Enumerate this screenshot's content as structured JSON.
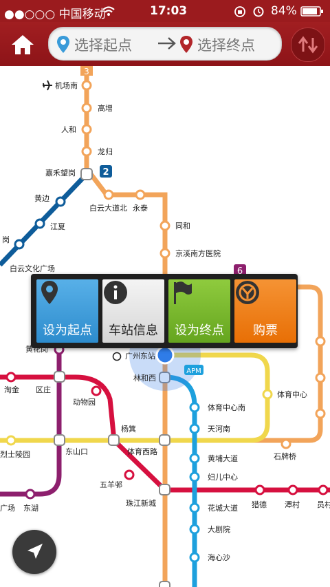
{
  "status_bar": {
    "carrier": "●●○○○ 中国移动",
    "time": "17:03",
    "battery": "84%"
  },
  "toolbar": {
    "home_icon": "home-icon",
    "start_placeholder": "选择起点",
    "end_placeholder": "选择终点",
    "swap_icon": "swap-route-icon"
  },
  "popup": {
    "set_start": "设为起点",
    "station_info": "车站信息",
    "set_end": "设为终点",
    "buy_ticket": "购票"
  },
  "map": {
    "line_badges": {
      "line3": "3",
      "line2": "2",
      "line6": "6",
      "apm": "APM"
    },
    "stations": {
      "jichangnan": "机场南",
      "gaozeng": "高增",
      "renhe": "人和",
      "longgui": "龙归",
      "jiahewanggang": "嘉禾望岗",
      "huangbian": "黄边",
      "jiangxia": "江夏",
      "xiaogang_partial": "岗",
      "baiyunwenhua": "白云文化广场",
      "baiyundadaobei": "白云大道北",
      "yongtai": "永泰",
      "tonghe": "同和",
      "jingxi": "京溪南方医院",
      "huanghuagang": "黄花岗",
      "guangzhoudong": "广州东站",
      "linhexi": "林和西",
      "taojin": "淘金",
      "ququzhuang": "区庄",
      "dongwuyuan": "动物园",
      "tiyuzhongxin": "体育中心",
      "tiyuzhongxinnan": "体育中心南",
      "tianhenan": "天河南",
      "lieshi": "烈士陵园",
      "dongshankou": "东山口",
      "yangji": "杨箕",
      "tiyuxilu": "体育西路",
      "shipaiqiao": "石牌桥",
      "wuyangcun": "五羊邨",
      "huangpudadao": "黄埔大道",
      "funvzhongxin": "妇儿中心",
      "guangchang": "广场",
      "donghu": "东湖",
      "zhujiangxincheng": "珠江新城",
      "liede": "猎德",
      "tancun": "潭村",
      "yuancun": "员村",
      "huachengdadao": "花城大道",
      "dajuyuan": "大剧院",
      "haixinsha": "海心沙"
    }
  },
  "colors": {
    "toolbar": "#9b1b1e",
    "line3": "#f2a45a",
    "line2": "#0e5c9a",
    "line1": "#f0d74c",
    "line5": "#d6103f",
    "line6": "#8d1f6d",
    "apm": "#1da0dd",
    "btn_start": "#3a9bd9",
    "btn_info": "#e6e6e6",
    "btn_end": "#78b82a",
    "btn_buy": "#f07f12"
  }
}
